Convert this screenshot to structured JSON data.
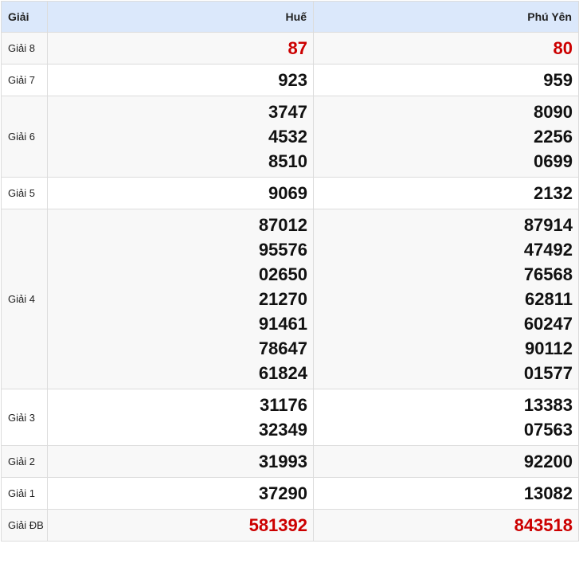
{
  "header": {
    "label": "Giải",
    "provinces": [
      "Huế",
      "Phú Yên"
    ]
  },
  "prizes": [
    {
      "key": "g8",
      "label": "Giải 8",
      "red": true,
      "values": [
        [
          "87"
        ],
        [
          "80"
        ]
      ]
    },
    {
      "key": "g7",
      "label": "Giải 7",
      "red": false,
      "values": [
        [
          "923"
        ],
        [
          "959"
        ]
      ]
    },
    {
      "key": "g6",
      "label": "Giải 6",
      "red": false,
      "values": [
        [
          "3747",
          "4532",
          "8510"
        ],
        [
          "8090",
          "2256",
          "0699"
        ]
      ]
    },
    {
      "key": "g5",
      "label": "Giải 5",
      "red": false,
      "values": [
        [
          "9069"
        ],
        [
          "2132"
        ]
      ]
    },
    {
      "key": "g4",
      "label": "Giải 4",
      "red": false,
      "values": [
        [
          "87012",
          "95576",
          "02650",
          "21270",
          "91461",
          "78647",
          "61824"
        ],
        [
          "87914",
          "47492",
          "76568",
          "62811",
          "60247",
          "90112",
          "01577"
        ]
      ]
    },
    {
      "key": "g3",
      "label": "Giải 3",
      "red": false,
      "values": [
        [
          "31176",
          "32349"
        ],
        [
          "13383",
          "07563"
        ]
      ]
    },
    {
      "key": "g2",
      "label": "Giải 2",
      "red": false,
      "values": [
        [
          "31993"
        ],
        [
          "92200"
        ]
      ]
    },
    {
      "key": "g1",
      "label": "Giải 1",
      "red": false,
      "values": [
        [
          "37290"
        ],
        [
          "13082"
        ]
      ]
    },
    {
      "key": "gdb",
      "label": "Giải ĐB",
      "red": true,
      "values": [
        [
          "581392"
        ],
        [
          "843518"
        ]
      ]
    }
  ],
  "colors": {
    "header_bg": "#dbe8fb",
    "red_number": "#cc0000",
    "number": "#111111"
  }
}
